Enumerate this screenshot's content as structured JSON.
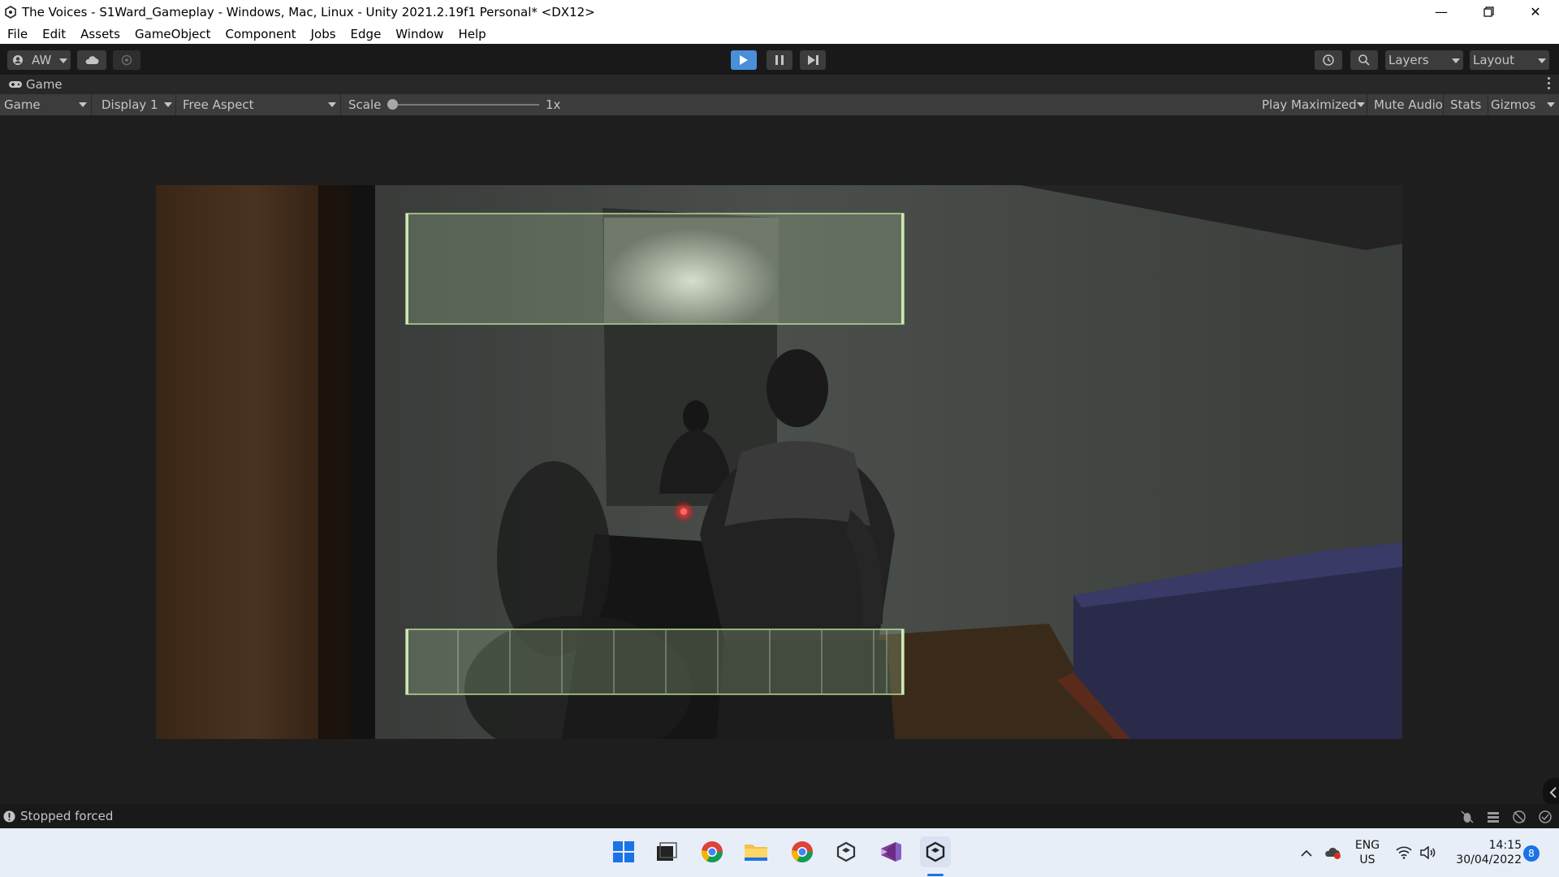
{
  "window": {
    "title": "The Voices - S1Ward_Gameplay - Windows, Mac, Linux - Unity 2021.2.19f1 Personal* <DX12>"
  },
  "menu": [
    "File",
    "Edit",
    "Assets",
    "GameObject",
    "Component",
    "Jobs",
    "Edge",
    "Window",
    "Help"
  ],
  "toolbar": {
    "account_label": "AW",
    "layers_label": "Layers",
    "layout_label": "Layout"
  },
  "panel": {
    "tab_label": "Game"
  },
  "gamebar": {
    "view_mode": "Game",
    "display": "Display 1",
    "aspect": "Free Aspect",
    "scale_label": "Scale",
    "scale_value": "1x",
    "play_maximized": "Play Maximized",
    "mute_audio": "Mute Audio",
    "stats": "Stats",
    "gizmos": "Gizmos"
  },
  "status": {
    "message": "Stopped forced"
  },
  "tray": {
    "lang_top": "ENG",
    "lang_bottom": "US",
    "time": "14:15",
    "date": "30/04/2022",
    "notification_count": "8"
  },
  "colors": {
    "unity_dark": "#191919",
    "toolbar_button": "#3c3c3c",
    "play_active": "#4a8fd8",
    "hud_panel_border": "#b9d89a",
    "taskbar": "#e8eef7"
  }
}
